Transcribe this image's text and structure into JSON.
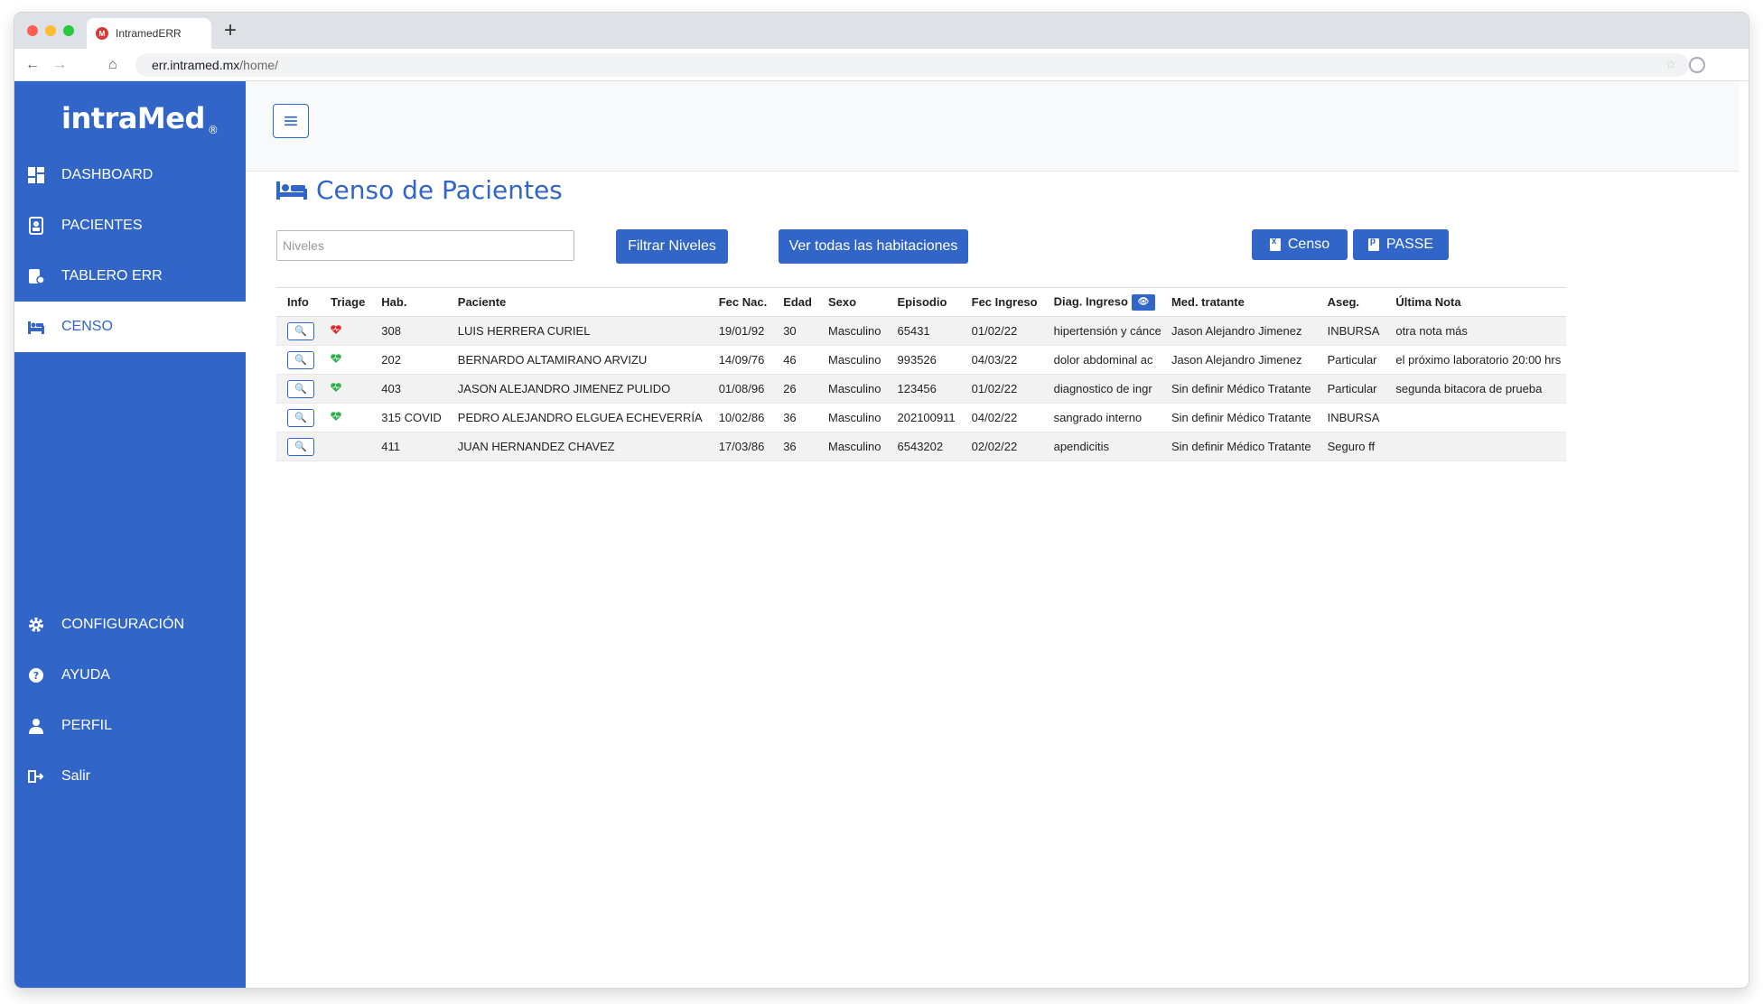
{
  "browser": {
    "tab_title": "IntramedERR",
    "tab_favicon": "M",
    "url_host": "err.intramed.mx",
    "url_path": "/home/"
  },
  "sidebar": {
    "logo": "intraMed",
    "logo_mark": "®",
    "items": [
      {
        "label": "DASHBOARD",
        "icon": "dashboard-icon"
      },
      {
        "label": "PACIENTES",
        "icon": "patient-id-icon"
      },
      {
        "label": "TABLERO ERR",
        "icon": "board-icon"
      },
      {
        "label": "CENSO",
        "icon": "bed-icon",
        "active": true
      },
      {
        "label": "CONFIGURACIÓN",
        "icon": "gear-icon"
      },
      {
        "label": "AYUDA",
        "icon": "help-icon"
      },
      {
        "label": "PERFIL",
        "icon": "user-icon"
      },
      {
        "label": "Salir",
        "icon": "logout-icon"
      }
    ]
  },
  "main": {
    "title": "Censo de Pacientes",
    "niveles_placeholder": "Niveles",
    "filtrar_label": "Filtrar Niveles",
    "ver_label": "Ver todas las habitaciones",
    "censo_label": "Censo",
    "passe_label": "PASSE",
    "table": {
      "headers": [
        "Info",
        "Triage",
        "Hab.",
        "Paciente",
        "Fec Nac.",
        "Edad",
        "Sexo",
        "Episodio",
        "Fec Ingreso",
        "Diag. Ingreso",
        "Med. tratante",
        "Aseg.",
        "Última Nota"
      ],
      "rows": [
        {
          "triage": "red",
          "hab": "308",
          "paciente": "LUIS HERRERA CURIEL",
          "fec_nac": "19/01/92",
          "edad": "30",
          "sexo": "Masculino",
          "episodio": "65431",
          "fec_ingreso": "01/02/22",
          "diag": "hipertensión y cánce",
          "med": "Jason Alejandro Jimenez",
          "aseg": "INBURSA",
          "nota": "otra nota más"
        },
        {
          "triage": "green",
          "hab": "202",
          "paciente": "BERNARDO ALTAMIRANO ARVIZU",
          "fec_nac": "14/09/76",
          "edad": "46",
          "sexo": "Masculino",
          "episodio": "993526",
          "fec_ingreso": "04/03/22",
          "diag": "dolor abdominal ac",
          "med": "Jason Alejandro Jimenez",
          "aseg": "Particular",
          "nota": "el próximo laboratorio 20:00 hrs"
        },
        {
          "triage": "green",
          "hab": "403",
          "paciente": "JASON ALEJANDRO JIMENEZ PULIDO",
          "fec_nac": "01/08/96",
          "edad": "26",
          "sexo": "Masculino",
          "episodio": "123456",
          "fec_ingreso": "01/02/22",
          "diag": "diagnostico de ingr",
          "med": "Sin definir Médico Tratante",
          "aseg": "Particular",
          "nota": "segunda bitacora de prueba"
        },
        {
          "triage": "green",
          "hab": "315 COVID",
          "paciente": "PEDRO ALEJANDRO ELGUEA ECHEVERRÍA",
          "fec_nac": "10/02/86",
          "edad": "36",
          "sexo": "Masculino",
          "episodio": "202100911",
          "fec_ingreso": "04/02/22",
          "diag": "sangrado interno",
          "med": "Sin definir Médico Tratante",
          "aseg": "INBURSA",
          "nota": ""
        },
        {
          "triage": "",
          "hab": "411",
          "paciente": "JUAN HERNANDEZ CHAVEZ",
          "fec_nac": "17/03/86",
          "edad": "36",
          "sexo": "Masculino",
          "episodio": "6543202",
          "fec_ingreso": "02/02/22",
          "diag": "apendicitis",
          "med": "Sin definir Médico Tratante",
          "aseg": "Seguro ff",
          "nota": ""
        }
      ]
    }
  },
  "colors": {
    "brand": "#3166c8",
    "triage_red": "#e0262a",
    "triage_green": "#2bb24c"
  }
}
